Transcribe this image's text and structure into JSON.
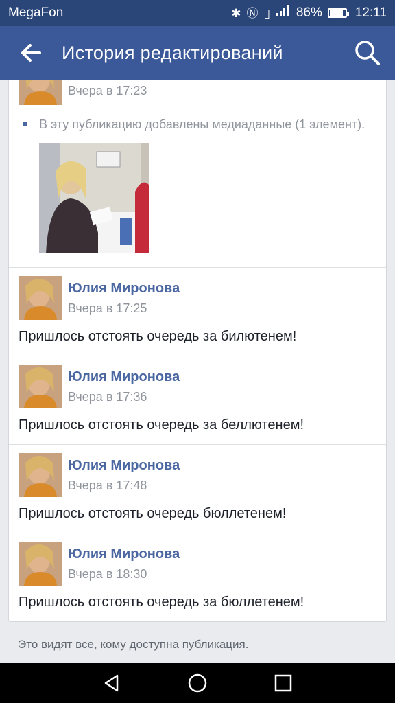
{
  "status_bar": {
    "carrier": "MegaFon",
    "battery": "86%",
    "battery_level": 0.86,
    "time": "12:11",
    "icons": [
      "bluetooth-icon",
      "nfc-icon",
      "vibrate-icon",
      "signal-icon",
      "battery-icon"
    ]
  },
  "app_bar": {
    "title": "История редактирований",
    "back_icon": "arrow-left-icon",
    "search_icon": "search-icon"
  },
  "history": {
    "first": {
      "time": "Вчера в 17:23",
      "change": "В эту публикацию добавлены медиаданные (1 элемент)."
    },
    "entries": [
      {
        "author": "Юлия Миронова",
        "time": "Вчера в 17:25",
        "text": "Пришлось отстоять очередь за билютенем!"
      },
      {
        "author": "Юлия Миронова",
        "time": "Вчера в 17:36",
        "text": "Пришлось отстоять очередь за беллютенем!"
      },
      {
        "author": "Юлия Миронова",
        "time": "Вчера в 17:48",
        "text": "Пришлось отстоять очередь бюллетенем!"
      },
      {
        "author": "Юлия Миронова",
        "time": "Вчера в 18:30",
        "text": "Пришлось отстоять очередь за бюллетенем!"
      }
    ]
  },
  "footer_note": "Это видят все, кому доступна публикация.",
  "nav": [
    "back-triangle-icon",
    "home-circle-icon",
    "recents-square-icon"
  ],
  "colors": {
    "header": "#3b5998",
    "status_bar": "#2a4578",
    "author": "#4b67a1"
  }
}
